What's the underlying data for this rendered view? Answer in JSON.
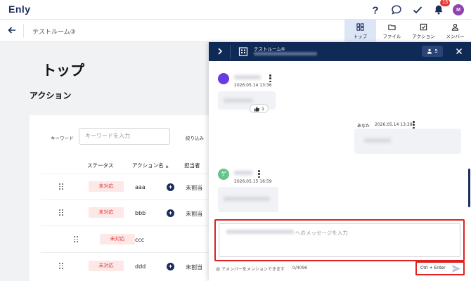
{
  "app": {
    "logo": "Enly",
    "notification_count": "13",
    "avatar_initial": "M"
  },
  "room": {
    "title": "テストルーム③"
  },
  "subtabs": [
    {
      "label": "トップ",
      "icon": "grid-icon",
      "active": true
    },
    {
      "label": "ファイル",
      "icon": "folder-icon",
      "active": false
    },
    {
      "label": "アクション",
      "icon": "checkbox-icon",
      "active": false
    },
    {
      "label": "メンバー",
      "icon": "person-icon",
      "active": false
    }
  ],
  "main": {
    "page_heading": "トップ",
    "section_heading": "アクション",
    "keyword_label": "キーワード",
    "keyword_placeholder": "キーワードを入力",
    "filter_label": "絞り込み",
    "columns": {
      "status": "ステータス",
      "action_name": "アクション名",
      "assignee": "担当者"
    },
    "rows": [
      {
        "status": "未対応",
        "name": "aaa",
        "assignee": "未割当"
      },
      {
        "status": "未対応",
        "name": "bbb",
        "assignee": "未割当"
      },
      {
        "status": "未対応",
        "name": "ccc",
        "assignee": ""
      },
      {
        "status": "未対応",
        "name": "ddd",
        "assignee": "未割当"
      }
    ]
  },
  "chat": {
    "header_title": "テストルーム④",
    "member_count": "5",
    "messages": [
      {
        "time": "2026.05.14 13:36",
        "reaction_count": "1"
      },
      {
        "author": "あなた",
        "time": "2026.05.14 13:38"
      },
      {
        "avatar_initial": "ゲ",
        "time": "2026.05.15 16:59"
      }
    ],
    "input_placeholder": "へのメッセージを入力",
    "mention_hint": "@ でメンバーをメンションできます",
    "char_counter": "0/4096",
    "send_hint": "Ctrl + Enter"
  },
  "colors": {
    "brand_navy": "#0f2a55",
    "status_red": "#e53935",
    "highlight_red": "#e02020",
    "avatar_purple": "#8e44ad",
    "guest_green": "#66c48a"
  }
}
